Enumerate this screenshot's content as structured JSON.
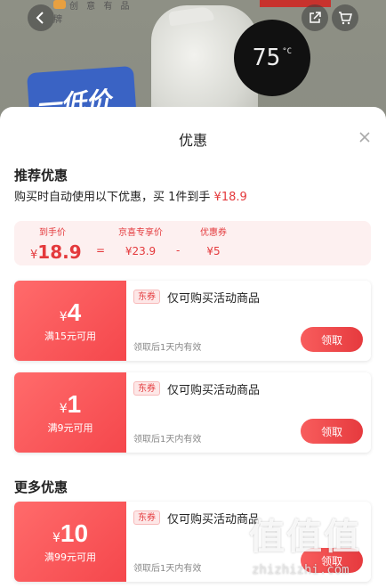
{
  "background": {
    "brand_text": "创 意 有 品 牌",
    "banner_text": "一低价",
    "temperature": "75",
    "temperature_unit": "°C"
  },
  "sheet": {
    "title": "优惠",
    "recommended": {
      "heading": "推荐优惠",
      "desc_prefix": "购买时自动使用以下优惠，买 1件到手 ",
      "desc_price": "¥18.9",
      "breakdown": {
        "total_label": "到手价",
        "total_currency": "¥",
        "total_value": "18.9",
        "equals": "=",
        "member_label": "京喜专享价",
        "member_value": "¥23.9",
        "minus": "-",
        "coupon_label": "优惠券",
        "coupon_value": "¥5"
      }
    },
    "coupons": [
      {
        "currency": "¥",
        "amount": "4",
        "condition": "满15元可用",
        "tag": "东券",
        "name": "仅可购买活动商品",
        "validity": "领取后1天内有效",
        "button": "领取"
      },
      {
        "currency": "¥",
        "amount": "1",
        "condition": "满9元可用",
        "tag": "东券",
        "name": "仅可购买活动商品",
        "validity": "领取后1天内有效",
        "button": "领取"
      }
    ],
    "more": {
      "heading": "更多优惠",
      "coupons": [
        {
          "currency": "¥",
          "amount": "10",
          "condition": "满99元可用",
          "tag": "东券",
          "name": "仅可购买活动商品",
          "validity": "领取后1天内有效",
          "button": "领取"
        }
      ]
    }
  },
  "watermark": {
    "logo": "值值值",
    "url": "zhizhizhi.com"
  },
  "colors": {
    "accent": "#e4393c",
    "coupon_gradient_start": "#ff6b6b",
    "coupon_gradient_end": "#f5474c",
    "breakdown_bg": "#fdf0f0"
  }
}
